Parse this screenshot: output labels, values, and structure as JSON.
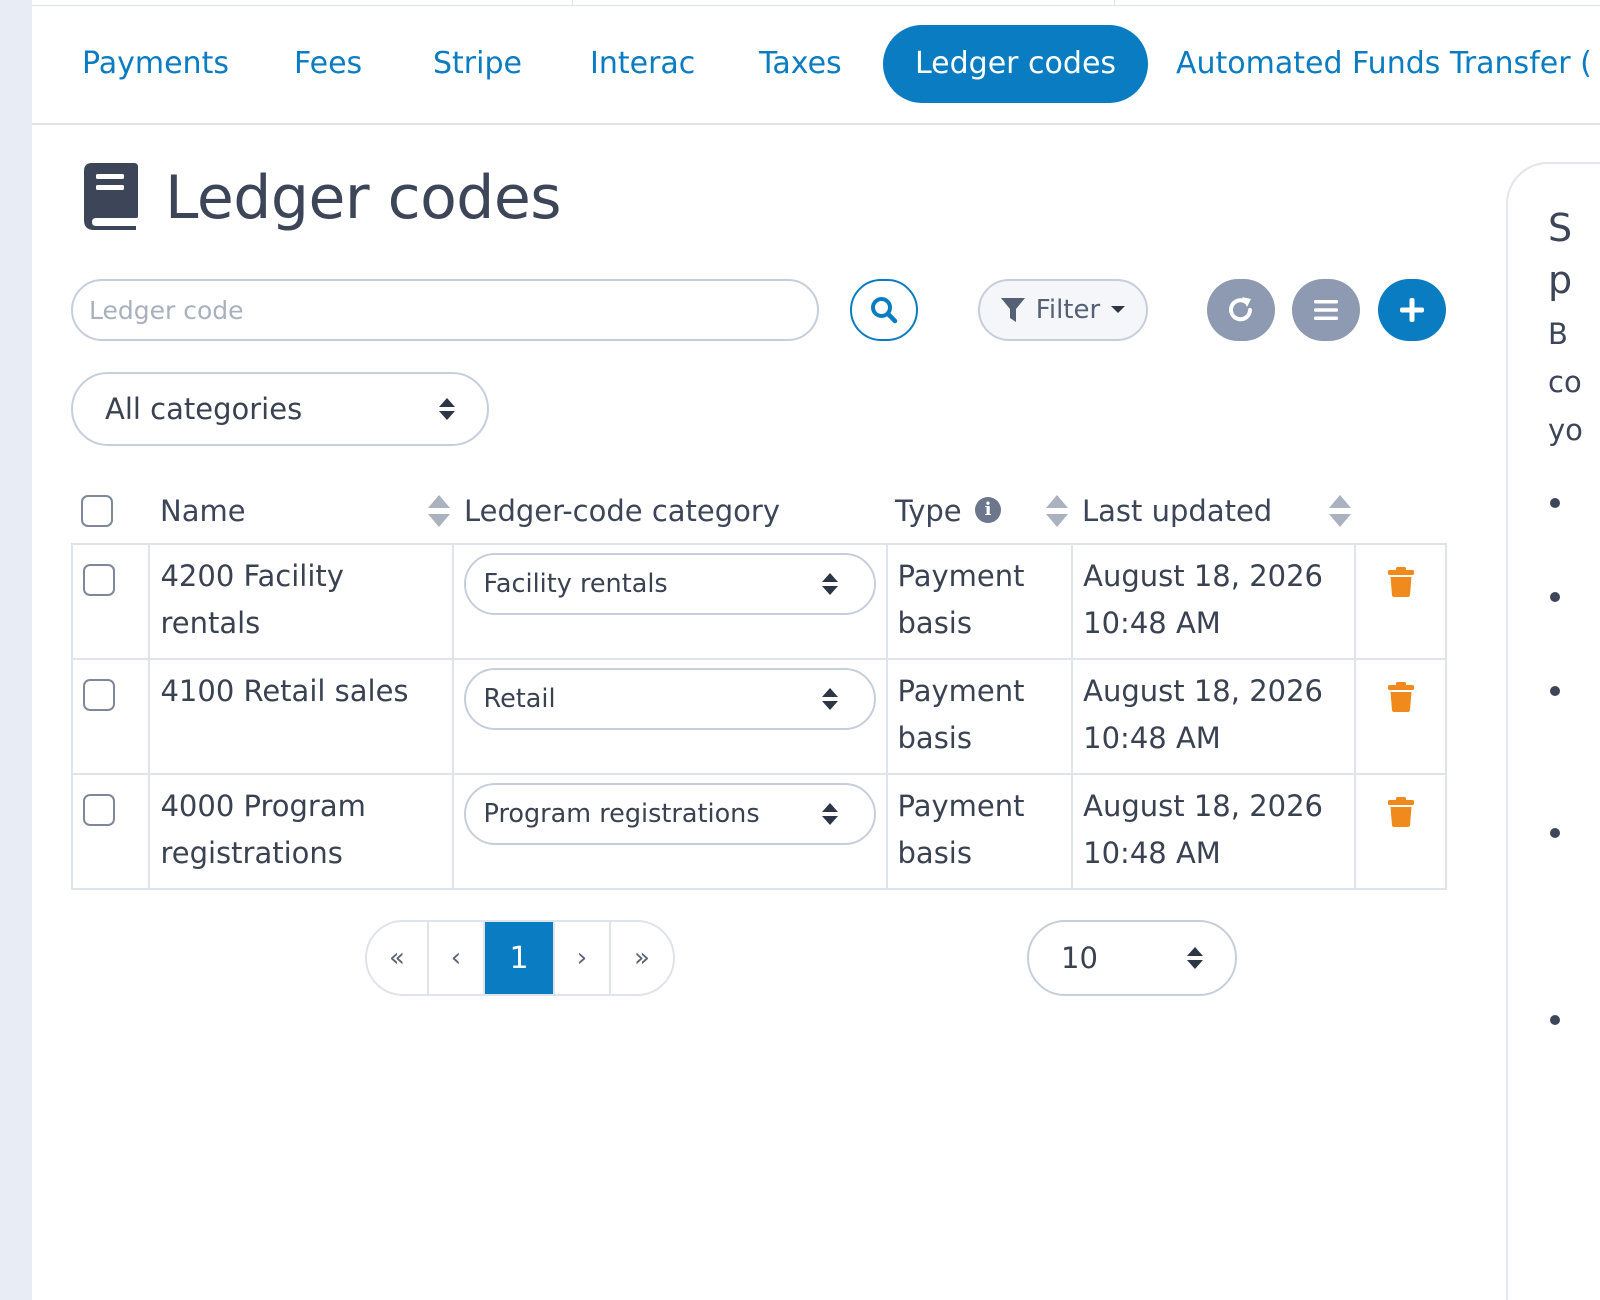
{
  "tabs": [
    {
      "label": "Payments",
      "active": false
    },
    {
      "label": "Fees",
      "active": false
    },
    {
      "label": "Stripe",
      "active": false
    },
    {
      "label": "Interac",
      "active": false
    },
    {
      "label": "Taxes",
      "active": false
    },
    {
      "label": "Ledger codes",
      "active": true
    },
    {
      "label": "Automated Funds Transfer (",
      "active": false
    }
  ],
  "page": {
    "title": "Ledger codes",
    "icon": "book-icon"
  },
  "toolbar": {
    "search_placeholder": "Ledger code",
    "search_value": "",
    "filter_label": "Filter",
    "icons": [
      "search-icon",
      "filter-icon",
      "refresh-icon",
      "list-icon",
      "plus-icon"
    ]
  },
  "category_filter": {
    "selected": "All categories"
  },
  "table": {
    "columns": [
      "Name",
      "Ledger-code category",
      "Type",
      "Last updated"
    ],
    "rows": [
      {
        "name": "4200 Facility rentals",
        "category": "Facility rentals",
        "type": "Payment basis",
        "updated": "August 18, 2026 10:48 AM"
      },
      {
        "name": "4100 Retail sales",
        "category": "Retail",
        "type": "Payment basis",
        "updated": "August 18, 2026 10:48 AM"
      },
      {
        "name": "4000 Program registrations",
        "category": "Program registrations",
        "type": "Payment basis",
        "updated": "August 18, 2026 10:48 AM"
      }
    ]
  },
  "pagination": {
    "first": "«",
    "prev": "‹",
    "current": "1",
    "next": "›",
    "last": "»",
    "per_page": "10"
  },
  "side_panel": {
    "title": "S\np",
    "text": "B\nco\nyo"
  },
  "colors": {
    "accent": "#0a7cc1",
    "muted_button": "#8e9ab1",
    "delete": "#f08a1c",
    "text": "#3d4558"
  }
}
